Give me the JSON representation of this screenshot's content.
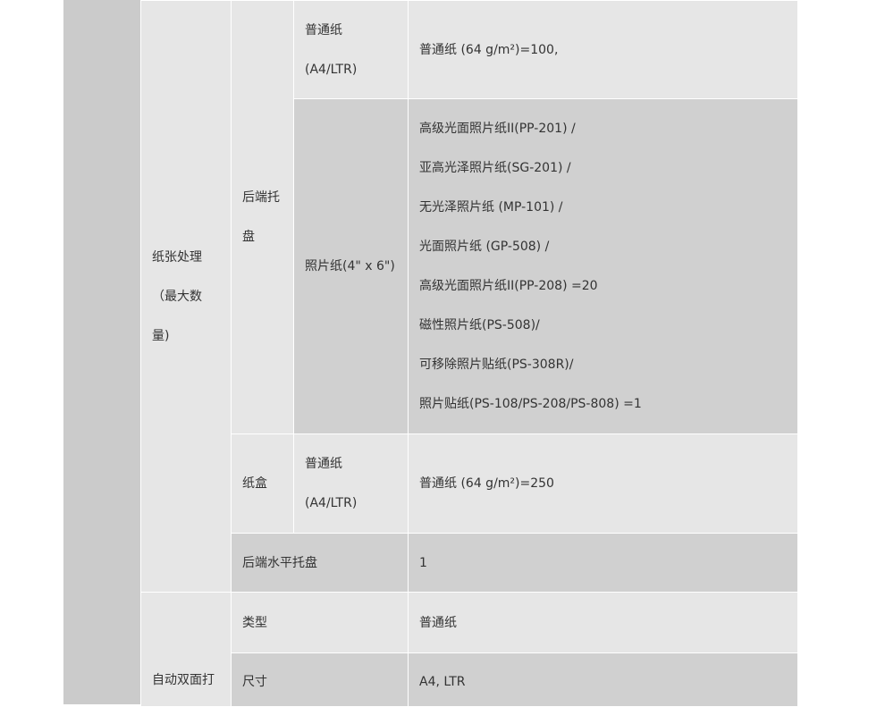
{
  "rows": {
    "paper_handling_label": [
      "纸张处理",
      "（最大数",
      "量)"
    ],
    "rear_tray_label": [
      "后端托",
      "盘"
    ],
    "rear_plain_paper_type": [
      "普通纸",
      "(A4/LTR)"
    ],
    "rear_plain_paper_value": "普通纸 (64 g/m²)=100,",
    "photo_paper_type": "照片纸(4\" x 6\")",
    "photo_paper_values": [
      "高级光面照片纸II(PP-201) /",
      "亚高光泽照片纸(SG-201) /",
      "无光泽照片纸 (MP-101) /",
      "光面照片纸 (GP-508) /",
      "高级光面照片纸II(PP-208) =20",
      "磁性照片纸(PS-508)/",
      "可移除照片贴纸(PS-308R)/",
      "照片贴纸(PS-108/PS-208/PS-808) =1"
    ],
    "cassette_label": "纸盒",
    "cassette_plain_paper_type": [
      "普通纸",
      "(A4/LTR)"
    ],
    "cassette_plain_paper_value": "普通纸 (64 g/m²)=250",
    "rear_flat_tray_label": "后端水平托盘",
    "rear_flat_tray_value": "1",
    "auto_duplex_label": "自动双面打",
    "duplex_type_label": "类型",
    "duplex_type_value": "普通纸",
    "duplex_size_label": "尺寸",
    "duplex_size_value": "A4, LTR"
  }
}
